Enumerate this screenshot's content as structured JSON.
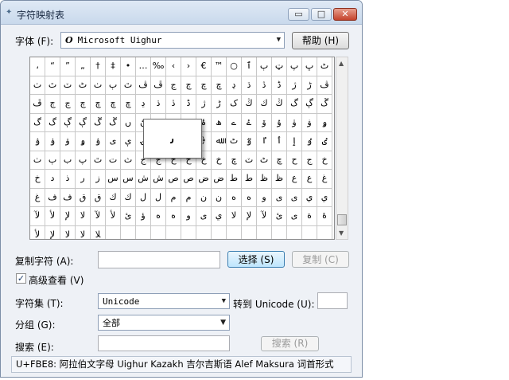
{
  "window": {
    "title": "字符映射表",
    "min_symbol": "▭",
    "max_symbol": "□",
    "close_symbol": "✕"
  },
  "font": {
    "label": "字体 (F):",
    "icon_glyph": "O",
    "value": "Microsoft Uighur",
    "help_button": "帮助 (H)"
  },
  "grid": {
    "rows": [
      [
        "،",
        "“",
        "”",
        "„",
        "†",
        "‡",
        "•",
        "…",
        "‰",
        "‹",
        "›",
        "€",
        "™",
        "○",
        "ٱ",
        "ٻ",
        "ټ",
        "پ",
        "ڀ",
        "ٹ"
      ],
      [
        "ٺ",
        "ٿ",
        "ٽ",
        "ٹ",
        "ٺ",
        "ٻ",
        "ٿ",
        "ڤ",
        "ڦ",
        "ڃ",
        "ڄ",
        "چ",
        "ڇ",
        "ڍ",
        "ڌ",
        "ڎ",
        "ڈ",
        "ژ",
        "ڑ",
        "ڤ"
      ],
      [
        "ڦ",
        "ڄ",
        "ڃ",
        "چ",
        "ڇ",
        "ڇ",
        "ڇ",
        "ڍ",
        "ڌ",
        "ڎ",
        "ڈ",
        "ژ",
        "ڑ",
        "ک",
        "ڭ",
        "ك",
        "ڭ",
        "گ",
        "ڳ",
        "ڱ"
      ],
      [
        "گ",
        "گ",
        "ڳ",
        "ڳ",
        "ڱ",
        "ڱ",
        "ں",
        "ڻ",
        "ہ",
        "ۀ",
        "ہ",
        "ۂ",
        "ھ",
        "ے",
        "ۓ",
        "ۆ",
        "ۇ",
        "ۈ",
        "ۋ",
        "ۅ"
      ],
      [
        "ۉ",
        "ۏ",
        "ۋ",
        "ۅ",
        "ۉ",
        "ی",
        "ې",
        "ۍ",
        "ێ",
        "ٮ",
        "﴾",
        "﴿",
        "ﷲ",
        "ٹ",
        "ٷ",
        "ٵ",
        "ٲ",
        "ٳ",
        "ٶ",
        "ٸ"
      ],
      [
        "ٺ",
        "ٻ",
        "ب",
        "پ",
        "ٿ",
        "ت",
        "ث",
        "ج",
        "ج",
        "ح",
        "ح",
        "خ",
        "خ",
        "ڇ",
        "ٽ",
        "ٹ",
        "ڇ",
        "ح",
        "ج",
        "خ"
      ],
      [
        "خ",
        "د",
        "ذ",
        "ر",
        "ز",
        "س",
        "س",
        "ش",
        "ش",
        "ص",
        "ص",
        "ض",
        "ض",
        "ط",
        "ط",
        "ظ",
        "ظ",
        "ع",
        "ع",
        "غ"
      ],
      [
        "غ",
        "ف",
        "ف",
        "ق",
        "ق",
        "ك",
        "ك",
        "ل",
        "ل",
        "م",
        "م",
        "ن",
        "ن",
        "ه",
        "ه",
        "و",
        "ى",
        "ى",
        "ي",
        "ي"
      ],
      [
        "لآ",
        "لأ",
        "لإ",
        "لا",
        "لآ",
        "لأ",
        "ئ",
        "ؤ",
        "ه",
        "ه",
        "و",
        "ى",
        "ي",
        "لا",
        "لإ",
        "لآ",
        "ئ",
        "ى",
        "ة",
        "ۀ"
      ],
      [
        "لأ",
        "لإ",
        "لا",
        "لا",
        "ﻼ",
        "",
        "",
        "",
        "",
        "",
        "",
        "",
        "",
        "",
        "",
        "",
        "",
        "",
        "",
        ""
      ]
    ],
    "selected_char": "ﯨ"
  },
  "copy": {
    "label": "复制字符 (A):",
    "value": "",
    "select_button": "选择 (S)",
    "copy_button": "复制 (C)"
  },
  "advanced": {
    "checked": true,
    "check_mark": "✓",
    "label": "高级查看 (V)"
  },
  "charset": {
    "label": "字符集 (T):",
    "value": "Unicode",
    "goto_label": "转到 Unicode (U):",
    "goto_value": ""
  },
  "group": {
    "label": "分组 (G):",
    "value": "全部"
  },
  "search": {
    "label": "搜索 (E):",
    "value": "",
    "button": "搜索 (R)"
  },
  "status": {
    "text": "U+FBE8: 阿拉伯文字母 Uighur Kazakh 吉尔吉斯语 Alef Maksura 词首形式"
  },
  "icons": {
    "dropdown": "▼",
    "scroll_up": "▲",
    "scroll_down": "▼"
  }
}
